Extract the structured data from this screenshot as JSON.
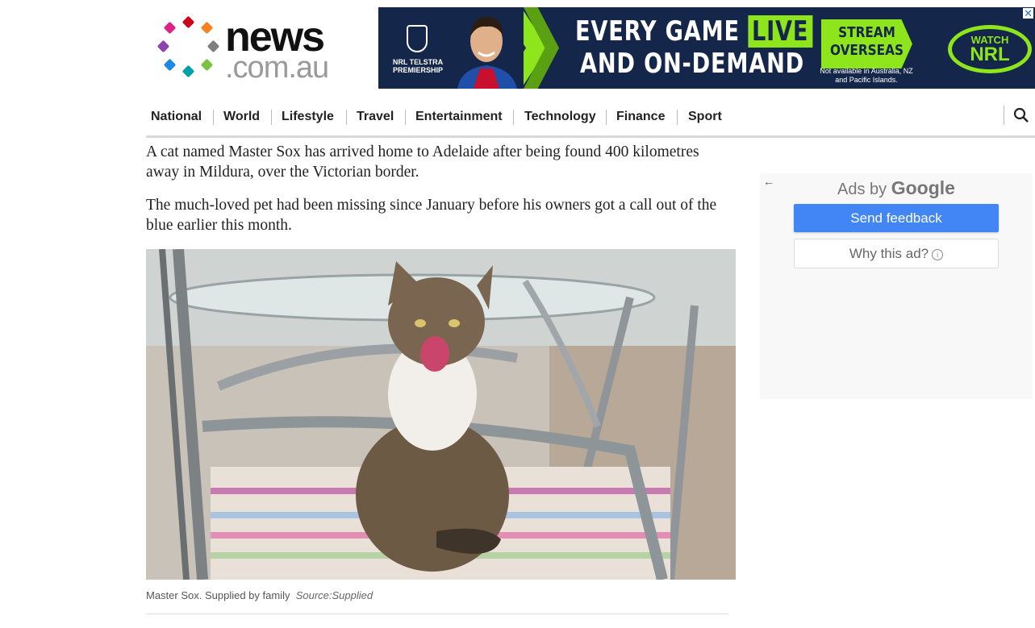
{
  "logo": {
    "line1": "news",
    "line2": ".com.au"
  },
  "banner": {
    "shield_sub": "NRL TELSTRA PREMIERSHIP",
    "headline1": "EVERY GAME",
    "headline1_live": "LIVE",
    "headline2": "AND ON-DEMAND",
    "stream1": "STREAM",
    "stream2": "OVERSEAS",
    "note": "Not available in Australia, NZ and Pacific Islands.",
    "watch1": "WATCH",
    "watch2": "NRL",
    "close": "✕"
  },
  "nav": {
    "items": [
      "National",
      "World",
      "Lifestyle",
      "Travel",
      "Entertainment",
      "Technology",
      "Finance",
      "Sport"
    ]
  },
  "article": {
    "para1": "A cat named Master Sox has arrived home to Adelaide after being found 400 kilometres away in Mildura, over the Victorian border.",
    "para2": "The much-loved pet had been missing since January before his owners got a call out of the blue earlier this month.",
    "caption": "Master Sox. Supplied by family",
    "source": "Source:Supplied"
  },
  "ad": {
    "ads_by": "Ads by",
    "google": "Google",
    "feedback": "Send feedback",
    "why": "Why this ad?",
    "info": "i",
    "back": "←"
  }
}
